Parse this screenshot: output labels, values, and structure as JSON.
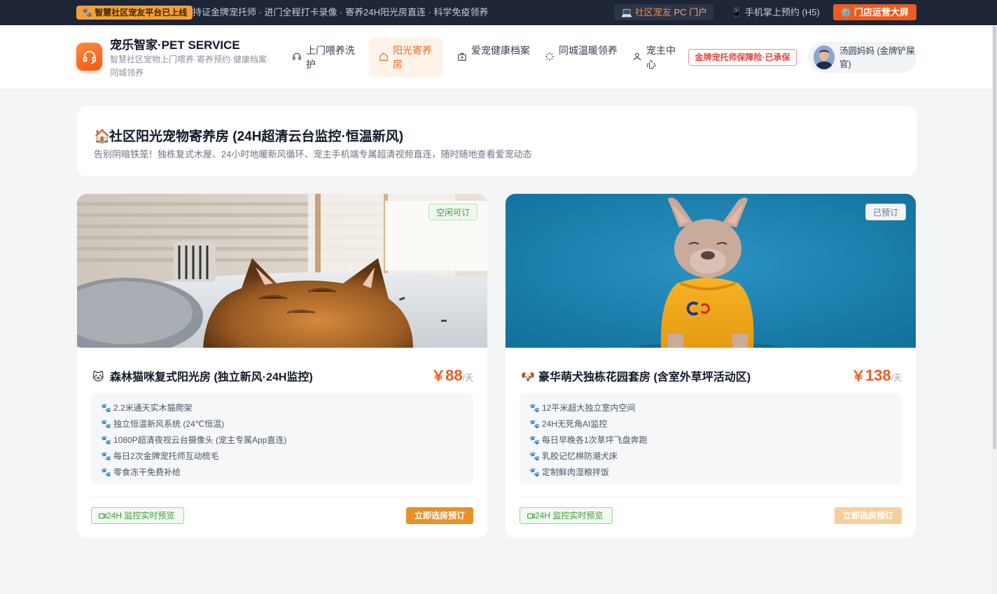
{
  "topbar": {
    "tag": "🐾 智慧社区宠友平台已上线",
    "marquee": "持证金牌宠托师 · 进门全程打卡录像 · 寄养24H阳光房直连 · 科学免疫领养",
    "portal_icon": "💻",
    "portal_a": "社区宠友",
    "portal_b": "PC 门户",
    "mobile_icon": "📱",
    "mobile_label": "手机掌上预约 (H5)",
    "dashboard_icon": "⚙️",
    "dashboard_label": "门店运营大屏"
  },
  "header": {
    "brand_title": "宠乐智家·PET SERVICE",
    "brand_sub": "智慧社区宠物上门喂养·寄养预约·健康档案·同城领养",
    "nav": [
      {
        "label": "上门喂养洗护",
        "icon": "headset-icon"
      },
      {
        "label": "阳光寄养房",
        "icon": "home-icon"
      },
      {
        "label": "爱宠健康档案",
        "icon": "medical-case-icon"
      },
      {
        "label": "同城温暖领养",
        "icon": "spinner-icon"
      },
      {
        "label": "宠主中心",
        "icon": "user-icon"
      }
    ],
    "insurance_badge": "金牌宠托师保障险·已承保",
    "user_name": "汤圆妈妈 (金牌铲屎官)"
  },
  "hero": {
    "emoji": "🏠",
    "title": "社区阳光宠物寄养房 (24H超清云台监控·恒温新风)",
    "subtitle": "告别阴暗铁笼！独栋复式木屋、24小时地暖新风循环、宠主手机端专属超清视频直连，随时随地查看爱宠动态"
  },
  "rooms": [
    {
      "status": "空闲可订",
      "emoji": "🐱",
      "title": "森林猫咪复式阳光房 (独立新风·24H监控)",
      "currency": "￥",
      "price": "88",
      "unit": "/天",
      "features": [
        "2.2米通天实木猫爬架",
        "独立恒温新风系统 (24℃恒温)",
        "1080P超清夜视云台摄像头 (宠主专属App直连)",
        "每日2次金牌宠托师互动梳毛",
        "零食冻干免费补给"
      ],
      "live_label": "24H 监控实时预览",
      "book_label": "立即选房预订",
      "book_color": "#e8912b"
    },
    {
      "status": "已预订",
      "emoji": "🐶",
      "title": "豪华萌犬独栋花园套房 (含室外草坪活动区)",
      "currency": "￥",
      "price": "138",
      "unit": "/天",
      "features": [
        "12平米超大独立室内空间",
        "24H无死角AI监控",
        "每日早晚各1次草坪飞盘奔跑",
        "乳胶记忆棉防潮犬床",
        "定制鲜肉湿粮拌饭"
      ],
      "live_label": "24H 监控实时预览",
      "book_label": "立即选房预订",
      "book_color": "#f5d09c"
    }
  ],
  "paw_icon": "🐾",
  "colors": {
    "accent": "#ee5b1c",
    "topbar": "#1e2536"
  }
}
